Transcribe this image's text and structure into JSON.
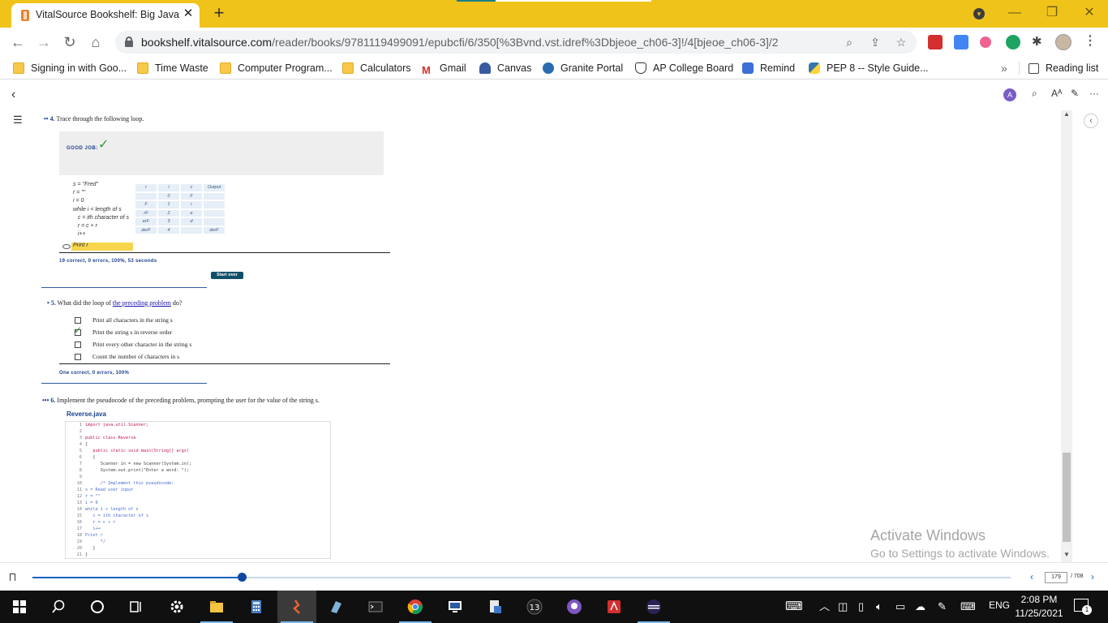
{
  "browser": {
    "tab_title": "VitalSource Bookshelf: Big Java: E",
    "tab_close": "✕",
    "new_tab": "+",
    "url_host": "bookshelf.vitalsource.com",
    "url_path": "/reader/books/9781119499091/epubcfi/6/350[%3Bvnd.vst.idref%3Dbjeoe_ch06-3]!/4[bjeoe_ch06-3]/2"
  },
  "bookmarks": {
    "items": [
      {
        "label": "Signing in with Goo...",
        "icon": "folder-icon"
      },
      {
        "label": "Time Waste",
        "icon": "folder-icon"
      },
      {
        "label": "Computer Program...",
        "icon": "folder-icon"
      },
      {
        "label": "Calculators",
        "icon": "folder-icon"
      },
      {
        "label": "Gmail",
        "icon": "gmail-icon"
      },
      {
        "label": "Canvas",
        "icon": "canvas-icon"
      },
      {
        "label": "Granite Portal",
        "icon": "granite-icon"
      },
      {
        "label": "AP College Board",
        "icon": "apcb-icon"
      },
      {
        "label": "Remind",
        "icon": "remind-icon"
      },
      {
        "label": "PEP 8 -- Style Guide...",
        "icon": "python-icon"
      }
    ],
    "more": "»",
    "reading_list": "Reading list"
  },
  "content": {
    "q4": {
      "number": "4.",
      "text": "Trace through the following loop.",
      "good_job": "GOOD JOB:",
      "pseudocode": [
        "s = \"Fred\"",
        "r = \"\"",
        "i = 0",
        "while i < length of s",
        "   c = ith character of s",
        "   r = c + r",
        "   i++"
      ],
      "print_line": "Print r",
      "table_header": [
        "r",
        "i",
        "c",
        "Output"
      ],
      "table_rows": [
        [
          "",
          "0",
          "F",
          ""
        ],
        [
          "F",
          "1",
          "r",
          ""
        ],
        [
          "rF",
          "2",
          "e",
          ""
        ],
        [
          "erF",
          "3",
          "d",
          ""
        ],
        [
          "derF",
          "4",
          "",
          "derF"
        ]
      ],
      "stats": "19 correct, 0 errors, 100%, 53 seconds",
      "start_over": "Start over"
    },
    "q5": {
      "number": "5.",
      "text_before": "What did the loop of ",
      "link": "the preceding problem",
      "text_after": " do?",
      "options": [
        {
          "label": "Print all characters in the string s",
          "checked": false
        },
        {
          "label": "Print the string s in reverse order",
          "checked": true
        },
        {
          "label": "Print every other character in the string s",
          "checked": false
        },
        {
          "label": "Count the number of characters in s",
          "checked": false
        }
      ],
      "stats": "One correct, 0 errors, 100%"
    },
    "q6": {
      "number": "6.",
      "text": "Implement the pseudocode of the preceding problem, prompting the user for the value of the string s.",
      "file": "Reverse.java",
      "code": [
        "import java.util.Scanner;",
        "",
        "public class Reverse",
        "{",
        "   public static void main(String[] args)",
        "   {",
        "      Scanner in = new Scanner(System.in);",
        "      System.out.print(\"Enter a word: \");",
        "",
        "      /* Implement this pseudocode:",
        "s = Read user input",
        "r = \"\"",
        "i = 0",
        "while i < length of s",
        "   c = ith character of s",
        "   r = c + r",
        "   i++",
        "Print r",
        "      */",
        "   }",
        "}"
      ]
    }
  },
  "watermark": {
    "line1": "Activate Windows",
    "line2": "Go to Settings to activate Windows."
  },
  "pager": {
    "current": "179",
    "total": "/ 708",
    "progress": 0.214
  },
  "taskbar": {
    "time": "2:08 PM",
    "date": "11/25/2021",
    "lang": "ENG",
    "notifications": "1"
  }
}
